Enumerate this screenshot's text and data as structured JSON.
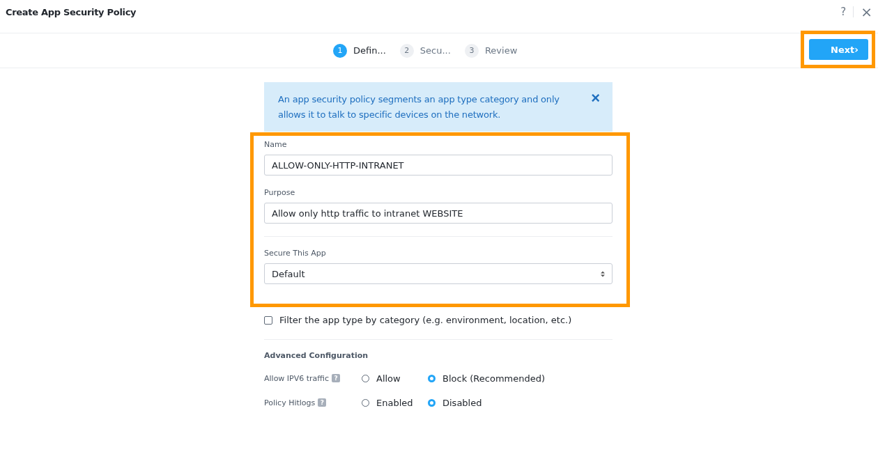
{
  "window": {
    "title": "Create App Security Policy",
    "help": "?",
    "close": "×"
  },
  "steps": [
    {
      "number": "1",
      "label": "Defin...",
      "selected": true
    },
    {
      "number": "2",
      "label": "Secu...",
      "selected": false
    },
    {
      "number": "3",
      "label": "Review",
      "selected": false
    }
  ],
  "next_button": {
    "label": "Next",
    "chevron": "›",
    "highlighted": true
  },
  "info_banner": {
    "text": "An app security policy segments an app type category and only allows it to talk to specific devices on the network.",
    "close": "×"
  },
  "form": {
    "highlighted": true,
    "name": {
      "label": "Name",
      "value": "ALLOW-ONLY-HTTP-INTRANET"
    },
    "purpose": {
      "label": "Purpose",
      "value": "Allow only http traffic to intranet WEBSITE"
    },
    "secure_app": {
      "label": "Secure This App",
      "value": "Default"
    }
  },
  "filter_checkbox": {
    "label": "Filter the app type by category (e.g. environment, location, etc.)",
    "checked": false
  },
  "advanced": {
    "title": "Advanced Configuration",
    "settings": [
      {
        "label": "Allow IPV6 traffic",
        "help": "?",
        "options": [
          {
            "label": "Allow",
            "selected": false
          },
          {
            "label": "Block (Recommended)",
            "selected": true
          }
        ]
      },
      {
        "label": "Policy Hitlogs",
        "help": "?",
        "options": [
          {
            "label": "Enabled",
            "selected": false
          },
          {
            "label": "Disabled",
            "selected": true
          }
        ]
      }
    ]
  }
}
